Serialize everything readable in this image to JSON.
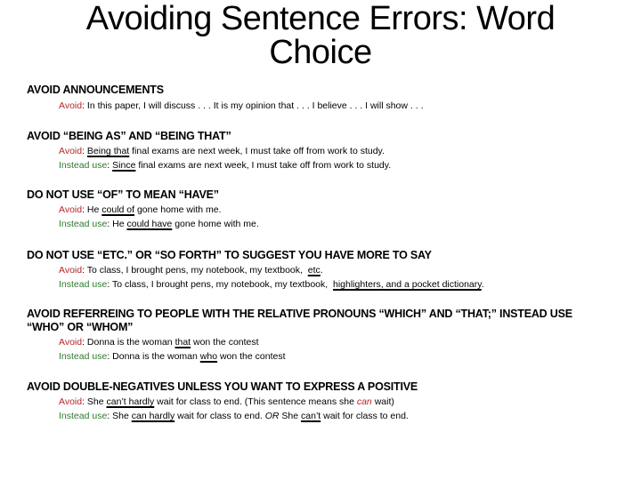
{
  "title": "Avoiding Sentence Errors: Word Choice",
  "labels": {
    "avoid": "Avoid",
    "instead": "Instead use",
    "colon": ": "
  },
  "colors": {
    "avoid": "#b4262a",
    "instead": "#2e7a2e"
  },
  "sections": [
    {
      "heading": "AVOID ANNOUNCEMENTS",
      "avoid": {
        "text": "In this paper, I will discuss . . . It is my opinion that . . . I believe . . .  I will show . . ."
      }
    },
    {
      "heading": "AVOID “BEING AS” AND “BEING THAT”",
      "avoid": {
        "pre": "",
        "u": "Being that",
        "post": " final exams are next week, I must take off from work to study."
      },
      "instead": {
        "pre": "",
        "u": "Since",
        "post": " final exams are next week, I must take off from work to study."
      }
    },
    {
      "heading": "DO NOT USE “OF” TO MEAN “HAVE”",
      "avoid": {
        "pre": "He ",
        "u": "could of",
        "post": " gone home with me."
      },
      "instead": {
        "pre": "He ",
        "u": "could have",
        "post": " gone home with me."
      }
    },
    {
      "heading": "DO NOT USE “ETC.” OR “SO FORTH” TO SUGGEST YOU HAVE MORE TO SAY",
      "avoid": {
        "pre": "To class, I brought pens, my notebook, my textbook,  ",
        "u": "etc",
        "post": "."
      },
      "instead": {
        "pre": "To class, I brought pens, my notebook, my textbook,  ",
        "u": "highlighters, and a pocket dictionary",
        "post": "."
      }
    },
    {
      "heading": "AVOID REFERREING TO PEOPLE WITH THE RELATIVE PRONOUNS “WHICH” AND “THAT;” INSTEAD USE “WHO” OR “WHOM”",
      "avoid": {
        "pre": "Donna is the woman ",
        "u": "that",
        "post": " won the contest"
      },
      "instead": {
        "pre": "Donna is the woman ",
        "u": "who",
        "post": " won the contest"
      }
    },
    {
      "heading": "AVOID DOUBLE-NEGATIVES UNLESS YOU WANT TO EXPRESS A POSITIVE",
      "avoid": {
        "pre": "She ",
        "u": "can’t hardly",
        "post": " wait for class to end. (This sentence means she ",
        "em": "can",
        "post2": " wait)"
      },
      "instead": {
        "pre": "She ",
        "u": "can hardly",
        "post": " wait for class to end. ",
        "em": "OR",
        "post2": " She ",
        "u2": "can’t",
        "post3": " wait for class to end."
      }
    }
  ]
}
